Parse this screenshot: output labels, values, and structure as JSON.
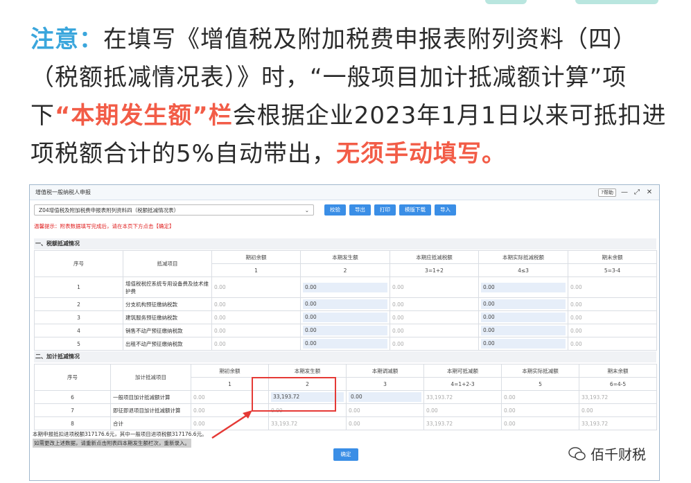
{
  "article": {
    "lead": "注意：",
    "p1": "在填写《增值税及附加税费申报表附列资料（四）（税额抵减情况表）》时，“一般项目加计抵减额计算”项下",
    "highlight1": "“本期发生额”栏",
    "p2": "会根据企业2023年1月1日以来可抵扣进项税额合计的5%自动带出，",
    "highlight2": "无须手动填写。"
  },
  "window": {
    "title": "增值税一般纳税人申报",
    "help_label": "帮助",
    "form_select_value": "Z04增值税及附加税费申报表附列资料四（税额抵减情况表）",
    "toolbar_buttons": [
      "校验",
      "导出",
      "打印",
      "模版下载",
      "导入"
    ],
    "warning": "温馨提示：附表数据填写完成后，请在本页下方点击【确定】"
  },
  "section1": {
    "title": "一、税额抵减情况",
    "headers": {
      "seq": "序号",
      "item": "抵减项目",
      "cols": [
        "期初余额",
        "本期发生额",
        "本期应抵减税额",
        "本期实际抵减税额",
        "期末余额"
      ],
      "nums": [
        "1",
        "2",
        "3=1+2",
        "4≤3",
        "5=3-4"
      ]
    },
    "rows": [
      {
        "seq": "1",
        "item": "增值税税控系统专用设备费及技术维护费",
        "values": [
          "0.00",
          "0.00",
          "0.00",
          "0.00",
          "0.00"
        ]
      },
      {
        "seq": "2",
        "item": "分支机构预征缴纳税款",
        "values": [
          "0.00",
          "0.00",
          "0.00",
          "0.00",
          "0.00"
        ]
      },
      {
        "seq": "3",
        "item": "建筑服务预征缴纳税款",
        "values": [
          "0.00",
          "0.00",
          "0.00",
          "0.00",
          "0.00"
        ]
      },
      {
        "seq": "4",
        "item": "销售不动产预征缴纳税款",
        "values": [
          "0.00",
          "0.00",
          "0.00",
          "0.00",
          "0.00"
        ]
      },
      {
        "seq": "5",
        "item": "出租不动产预征缴纳税款",
        "values": [
          "0.00",
          "0.00",
          "0.00",
          "0.00",
          "0.00"
        ]
      }
    ]
  },
  "section2": {
    "title": "二、加计抵减情况",
    "headers": {
      "seq": "序号",
      "item": "加计抵减项目",
      "cols": [
        "期初余额",
        "本期发生额",
        "本期调减额",
        "本期可抵减额",
        "本期实际抵减额",
        "期末余额"
      ],
      "nums": [
        "1",
        "2",
        "3",
        "4=1+2-3",
        "5",
        "6=4-5"
      ]
    },
    "rows": [
      {
        "seq": "6",
        "item": "一般项目加计抵减额计算",
        "values": [
          "0.00",
          "33,193.72",
          "0.00",
          "33,193.72",
          "0.00",
          "33,193.72"
        ]
      },
      {
        "seq": "7",
        "item": "即征即退项目加计抵减额计算",
        "values": [
          "0.00",
          "0.00",
          "0.00",
          "0.00",
          "0.00",
          "0.00"
        ]
      },
      {
        "seq": "8",
        "item": "合计",
        "values": [
          "0.00",
          "33,193.72",
          "0.00",
          "33,193.72",
          "0.00",
          "33,193.72"
        ]
      }
    ]
  },
  "footnote1": "本期申报抵扣进项税额317176.6元，其中一般项目进项税额317176.6元。",
  "footnote2": "如需更改上述数据，请重新点击附表四本期发生额栏次，重新录入。",
  "confirm_label": "确定",
  "watermark": "佰千财税"
}
